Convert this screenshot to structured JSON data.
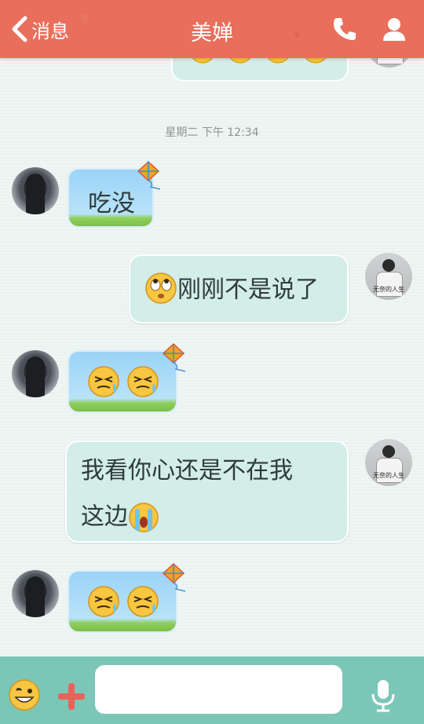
{
  "header": {
    "back_label": "消息",
    "title": "美婵",
    "bg_color": "#e96e5c"
  },
  "timestamp": "星期二 下午 12:34",
  "messages": [
    {
      "direction": "in",
      "text": "吃没"
    },
    {
      "direction": "out",
      "text": "刚刚不是说了",
      "emoji_prefix": "eye-roll-emoji"
    },
    {
      "direction": "in",
      "emojis": [
        "tired-sweat-emoji",
        "tired-sweat-emoji"
      ]
    },
    {
      "direction": "out",
      "line1": "我看你心还是不在我",
      "line2": "这边",
      "emoji_suffix": "crying-emoji"
    },
    {
      "direction": "in",
      "emojis": [
        "tired-sweat-emoji",
        "tired-sweat-emoji"
      ]
    }
  ],
  "avatar_caption": "无奈的人生",
  "input": {
    "value": "",
    "placeholder": ""
  },
  "toolbar": {
    "accent": "#7cc6b8"
  }
}
